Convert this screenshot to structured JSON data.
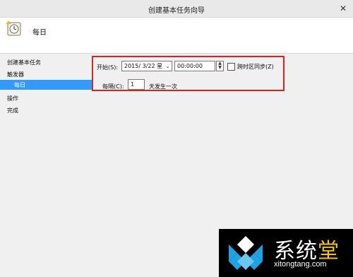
{
  "window": {
    "title": "创建基本任务向导",
    "close_label": "✕"
  },
  "header": {
    "title": "每日",
    "icon": "clock-calendar-icon"
  },
  "sidebar": {
    "items": [
      {
        "label": "创建基本任务"
      },
      {
        "label": "触发器"
      },
      {
        "label": "每日",
        "selected": true
      },
      {
        "label": "操作"
      },
      {
        "label": "完成"
      }
    ]
  },
  "form": {
    "start_label": "开始(S):",
    "date_value": "2015/ 3/22 星",
    "time_value": "00:00:00",
    "sync_label": "跨时区同步(Z)",
    "sync_checked": false,
    "every_label": "每隔(C):",
    "every_value": "1",
    "every_unit": "天发生一次"
  },
  "watermark": {
    "brand_part1": "系统",
    "brand_part2": "堂",
    "url": "xitongtang.com"
  },
  "colors": {
    "selection": "#3399ff",
    "outline": "#dd2222",
    "watermark_bg": "#000000",
    "watermark_accent": "#f7c500"
  }
}
